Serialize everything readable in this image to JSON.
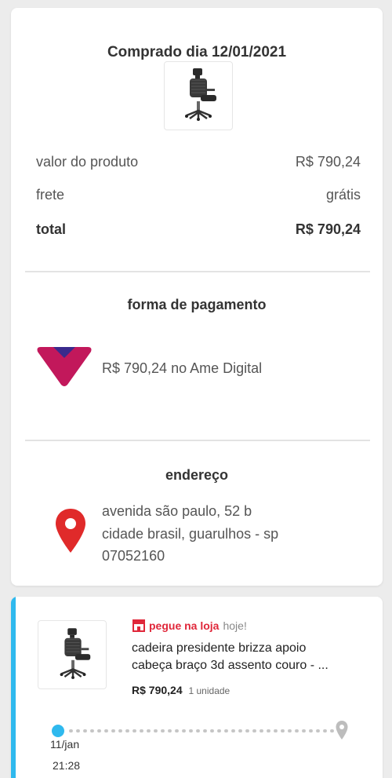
{
  "summary": {
    "purchase_title": "Comprado dia 12/01/2021",
    "rows": {
      "valor_label": "valor do produto",
      "valor_value": "R$ 790,24",
      "frete_label": "frete",
      "frete_value": "grátis",
      "total_label": "total",
      "total_value": "R$ 790,24"
    },
    "payment": {
      "title": "forma de pagamento",
      "text": "R$ 790,24 no Ame Digital",
      "logo_icon": "ame-digital-logo"
    },
    "address": {
      "title": "endereço",
      "line1": "avenida são paulo, 52 b",
      "line2": "cidade brasil, guarulhos - sp",
      "line3": "07052160",
      "icon": "location-pin-icon"
    }
  },
  "order": {
    "pickup_label": "pegue na loja",
    "pickup_when": "hoje!",
    "product_name_line1": "cadeira presidente brizza apoio",
    "product_name_line2": "cabeça braço 3d assento couro - ...",
    "price": "R$ 790,24",
    "quantity": "1 unidade",
    "tracking": {
      "date": "11/jan",
      "time": "21:28"
    }
  },
  "colors": {
    "accent": "#2fb9ee",
    "pickup_red": "#e0273a",
    "ame_magenta": "#c2185b",
    "pin_red": "#e02a2a"
  }
}
